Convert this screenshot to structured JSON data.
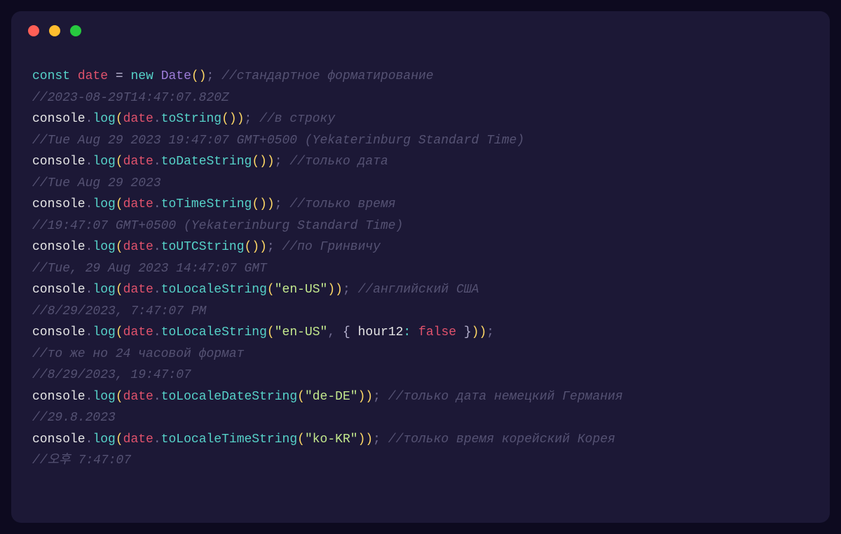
{
  "traffic": {
    "red": "close",
    "yellow": "minimize",
    "green": "zoom"
  },
  "code": {
    "l1": {
      "kw1": "const",
      "var": "date",
      "op": "=",
      "kw2": "new",
      "cls": "Date",
      "cmt": "//стандартное форматирование"
    },
    "l2": {
      "cmt": "//2023-08-29T14:47:07.820Z"
    },
    "l3": {
      "obj": "console",
      "m1": "log",
      "var": "date",
      "m2": "toString",
      "cmt": "//в строку"
    },
    "l4": {
      "cmt": "//Tue Aug 29 2023 19:47:07 GMT+0500 (Yekaterinburg Standard Time)"
    },
    "l5": {
      "obj": "console",
      "m1": "log",
      "var": "date",
      "m2": "toDateString",
      "cmt": "//только дата"
    },
    "l6": {
      "cmt": "//Tue Aug 29 2023"
    },
    "l7": {
      "obj": "console",
      "m1": "log",
      "var": "date",
      "m2": "toTimeString",
      "cmt": "//только время"
    },
    "l8": {
      "cmt": "//19:47:07 GMT+0500 (Yekaterinburg Standard Time)"
    },
    "l9": {
      "obj": "console",
      "m1": "log",
      "var": "date",
      "m2": "toUTCString",
      "cmt": "//по Гринвичу"
    },
    "l10": {
      "cmt": "//Tue, 29 Aug 2023 14:47:07 GMT"
    },
    "l11": {
      "obj": "console",
      "m1": "log",
      "var": "date",
      "m2": "toLocaleString",
      "str": "\"en-US\"",
      "cmt": "//английский США"
    },
    "l12": {
      "cmt": "//8/29/2023, 7:47:07 PM"
    },
    "l13": {
      "obj": "console",
      "m1": "log",
      "var": "date",
      "m2": "toLocaleString",
      "str": "\"en-US\"",
      "prop": "hour12",
      "bool": "false"
    },
    "l14": {
      "cmt": "//то же но 24 часовой формат"
    },
    "l15": {
      "cmt": "//8/29/2023, 19:47:07"
    },
    "l16": {
      "obj": "console",
      "m1": "log",
      "var": "date",
      "m2": "toLocaleDateString",
      "str": "\"de-DE\"",
      "cmt": "//только дата немецкий Германия"
    },
    "l17": {
      "cmt": "//29.8.2023"
    },
    "l18": {
      "obj": "console",
      "m1": "log",
      "var": "date",
      "m2": "toLocaleTimeString",
      "str": "\"ko-KR\"",
      "cmt": "//только время корейский Корея"
    },
    "l19": {
      "cmt": "//오후 7:47:07"
    }
  }
}
